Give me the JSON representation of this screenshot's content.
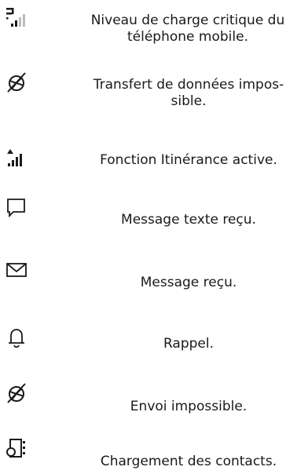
{
  "legend": {
    "items": [
      {
        "icon": "low-battery-signal-icon",
        "text": "Niveau de charge critique du téléphone mobile."
      },
      {
        "icon": "data-transfer-blocked-icon",
        "text": "Transfert de données impos-sible."
      },
      {
        "icon": "roaming-icon",
        "text": "Fonction Itinérance active."
      },
      {
        "icon": "speech-bubble-icon",
        "text": "Message texte reçu."
      },
      {
        "icon": "envelope-icon",
        "text": "Message reçu."
      },
      {
        "icon": "bell-icon",
        "text": "Rappel."
      },
      {
        "icon": "send-blocked-icon",
        "text": "Envoi impossible."
      },
      {
        "icon": "contacts-loading-icon",
        "text": "Chargement des contacts."
      }
    ]
  }
}
